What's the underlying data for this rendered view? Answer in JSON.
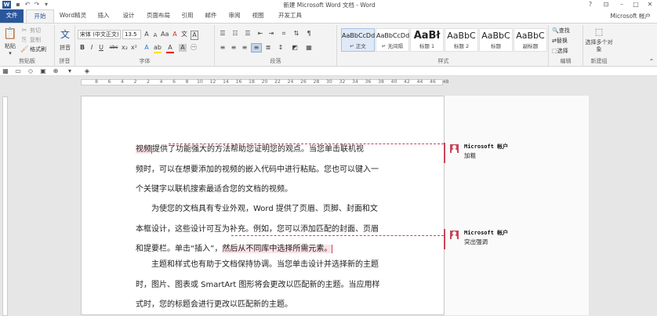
{
  "window": {
    "title": "新建 Microsoft Word 文档 - Word",
    "app_letter": "W",
    "account": "Microsoft 帐户"
  },
  "tabs": [
    "文件",
    "开始",
    "Word精灵",
    "插入",
    "设计",
    "页面布局",
    "引用",
    "邮件",
    "审阅",
    "视图",
    "开发工具"
  ],
  "ribbon": {
    "clipboard": {
      "label": "剪贴板",
      "paste": "粘贴",
      "cut": "剪切",
      "copy": "复制",
      "format_painter": "格式刷"
    },
    "pinyin": {
      "label": "拼音",
      "button": "拼音"
    },
    "font": {
      "label": "字体",
      "family": "宋体 (中文正文)",
      "size": "13.5"
    },
    "paragraph": {
      "label": "段落"
    },
    "styles": {
      "label": "样式",
      "items": [
        {
          "sample": "AaBbCcDd",
          "name": "↵ 正文"
        },
        {
          "sample": "AaBbCcDd",
          "name": "↵ 无间隔"
        },
        {
          "sample": "AaBł",
          "name": "标题 1"
        },
        {
          "sample": "AaBbC",
          "name": "标题 2"
        },
        {
          "sample": "AaBbC",
          "name": "标题"
        },
        {
          "sample": "AaBbC",
          "name": "副标题"
        }
      ]
    },
    "editing": {
      "label": "编辑",
      "find": "查找",
      "replace": "替换",
      "select": "选择"
    },
    "new_group": {
      "label": "新建组",
      "button": "选择多个对象"
    }
  },
  "ruler": {
    "numbers": [
      "8",
      "6",
      "4",
      "2",
      "2",
      "4",
      "6",
      "8",
      "10",
      "12",
      "14",
      "16",
      "18",
      "20",
      "22",
      "24",
      "26",
      "28",
      "30",
      "32",
      "34",
      "36",
      "38",
      "40",
      "42",
      "44",
      "46",
      "48"
    ]
  },
  "document": {
    "p1": [
      "视频",
      "提供了功能强大的方法帮助您证明您的观点。当您单击联机视",
      "频时，可以在想要添加的视频的嵌入代码中进行粘贴。您也可以键入一",
      "个关键字以联机搜索最适合您的文档的视频。"
    ],
    "p2": [
      "为使您的文档具有专业外观，Word 提供了页眉、页脚、封面和文",
      "本框设计，这些设计可互为补充。例如，您可以添加匹配的封面、页眉",
      "和提要栏。单击“插入”，",
      "然后从不同库中选择所需元素。"
    ],
    "p3": [
      "主题和样式也有助于文档保持协调。当您单击设计并选择新的主题",
      "时，图片、图表或 SmartArt 图形将会更改以匹配新的主题。当应用样",
      "式时，您的标题会进行更改以匹配新的主题。"
    ]
  },
  "comments": [
    {
      "author": "Microsoft 帐户",
      "text": "加粗"
    },
    {
      "author": "Microsoft 帐户",
      "text": "突出强调"
    }
  ],
  "colors": {
    "accent": "#2b579a",
    "comment": "#c8465a",
    "highlight": "#f7d0d7"
  }
}
